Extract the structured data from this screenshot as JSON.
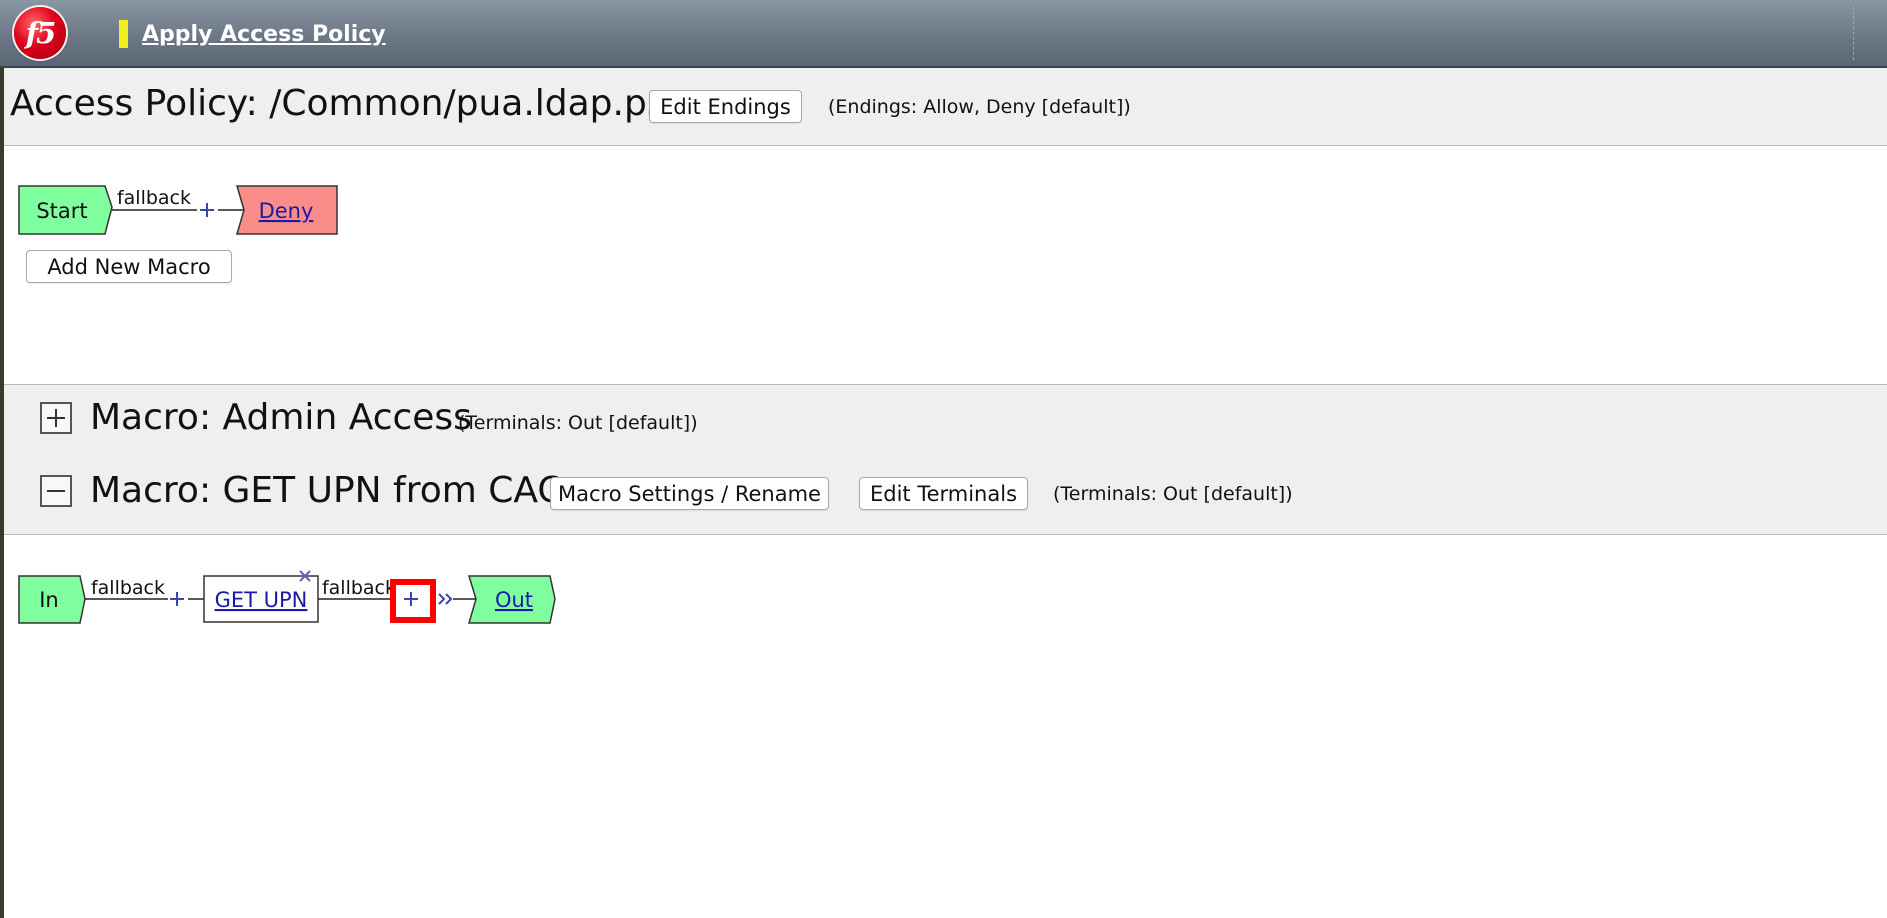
{
  "header": {
    "apply_label": "Apply Access Policy",
    "logo_text": "f5"
  },
  "policy": {
    "title": "Access Policy: /Common/pua.ldap.psp",
    "edit_endings_label": "Edit Endings",
    "endings_note": "(Endings: Allow, Deny [default])",
    "flow": {
      "start_label": "Start",
      "branch_label": "fallback",
      "end_label": "Deny"
    },
    "add_macro_label": "Add New Macro"
  },
  "macros": [
    {
      "title": "Macro: Admin Access",
      "state": "collapsed",
      "terminals_note": "(Terminals: Out [default])"
    },
    {
      "title": "Macro: GET UPN from CAC",
      "state": "expanded",
      "settings_label": "Macro Settings / Rename",
      "edit_terminals_label": "Edit Terminals",
      "terminals_note": "(Terminals: Out [default])",
      "flow": {
        "in_label": "In",
        "branch1_label": "fallback",
        "action_label": "GET UPN",
        "branch2_label": "fallback",
        "out_label": "Out"
      }
    }
  ],
  "colors": {
    "terminal_green": "#80ff9f",
    "deny_red": "#fa8c8a",
    "link_blue": "#1a1aa6",
    "highlight_red": "#ff0000",
    "plus_blue": "#3848a8"
  },
  "icons": {
    "add": "plus-icon",
    "delete": "close-icon",
    "expand": "plus-box-icon",
    "collapse": "minus-box-icon",
    "goto": "double-chevron-icon"
  }
}
